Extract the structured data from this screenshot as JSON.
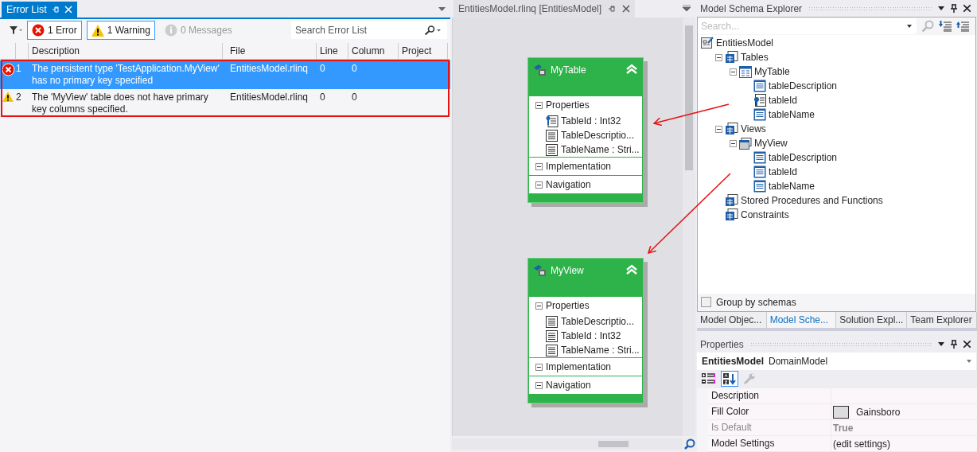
{
  "error_list": {
    "title": "Error List",
    "filters": [
      {
        "kind": "error",
        "label": "1 Error",
        "selected": true
      },
      {
        "kind": "warning",
        "label": "1 Warning",
        "selected": true
      },
      {
        "kind": "message",
        "label": "0 Messages",
        "selected": false
      }
    ],
    "search": {
      "placeholder": "Search Error List"
    },
    "columns": [
      "Description",
      "File",
      "Line",
      "Column",
      "Project"
    ],
    "rows": [
      {
        "kind": "error",
        "number": "1",
        "description": "The persistent type 'TestApplication.MyView' has no primary key specified",
        "file": "EntitiesModel.rlinq",
        "line": "0",
        "column": "0",
        "selected": true
      },
      {
        "kind": "warning",
        "number": "2",
        "description": "The 'MyView' table does not have primary key columns specified.",
        "file": "EntitiesModel.rlinq",
        "line": "0",
        "column": "0",
        "selected": false
      }
    ]
  },
  "designer": {
    "tab": "EntitiesModel.rlinq [EntitiesModel]",
    "entities": [
      {
        "name": "MyTable",
        "sections": [
          {
            "title": "Properties",
            "expanded": true,
            "items": [
              {
                "kind": "key",
                "text": "TableId : Int32"
              },
              {
                "kind": "column",
                "text": "TableDescriptio..."
              },
              {
                "kind": "column",
                "text": "TableName  : Stri..."
              }
            ]
          },
          {
            "title": "Implementation",
            "expanded": true
          },
          {
            "title": "Navigation",
            "expanded": true
          }
        ]
      },
      {
        "name": "MyView",
        "sections": [
          {
            "title": "Properties",
            "expanded": true,
            "items": [
              {
                "kind": "column",
                "text": "TableDescriptio..."
              },
              {
                "kind": "column",
                "text": "TableId : Int32"
              },
              {
                "kind": "column",
                "text": "TableName  : Stri..."
              }
            ]
          },
          {
            "title": "Implementation",
            "expanded": true
          },
          {
            "title": "Navigation",
            "expanded": true
          }
        ]
      }
    ]
  },
  "schema_explorer": {
    "title": "Model Schema Explorer",
    "search": {
      "placeholder": "Search..."
    },
    "tree": [
      {
        "kind": "model",
        "label": "EntitiesModel",
        "children": [
          {
            "kind": "folder",
            "label": "Tables",
            "expanded": true,
            "children": [
              {
                "kind": "table",
                "label": "MyTable",
                "expanded": true,
                "children": [
                  {
                    "kind": "column",
                    "label": "tableDescription"
                  },
                  {
                    "kind": "key",
                    "label": "tableId"
                  },
                  {
                    "kind": "column",
                    "label": "tableName"
                  }
                ]
              }
            ]
          },
          {
            "kind": "folder",
            "label": "Views",
            "expanded": true,
            "children": [
              {
                "kind": "view",
                "label": "MyView",
                "expanded": true,
                "children": [
                  {
                    "kind": "column",
                    "label": "tableDescription"
                  },
                  {
                    "kind": "column",
                    "label": "tableId"
                  },
                  {
                    "kind": "column",
                    "label": "tableName"
                  }
                ]
              }
            ]
          },
          {
            "kind": "folder",
            "label": "Stored Procedures and Functions"
          },
          {
            "kind": "folder",
            "label": "Constraints"
          }
        ]
      }
    ],
    "group_by_schemas": {
      "label": "Group by schemas",
      "checked": false
    },
    "tabs": [
      {
        "label": "Model Objec...",
        "selected": false
      },
      {
        "label": "Model Sche...",
        "selected": true
      },
      {
        "label": "Solution Expl...",
        "selected": false
      },
      {
        "label": "Team Explorer",
        "selected": false
      }
    ]
  },
  "properties": {
    "title": "Properties",
    "object_name": "EntitiesModel",
    "object_type": "DomainModel",
    "rows": [
      {
        "kind": "text",
        "name": "Description",
        "disabled": false
      },
      {
        "kind": "color",
        "name": "Fill Color",
        "value": "Gainsboro",
        "color": "#dcdcdc",
        "disabled": false
      },
      {
        "kind": "bold",
        "name": "Is Default",
        "value": "True",
        "disabled": true
      },
      {
        "kind": "text",
        "name": "Model Settings",
        "value": "(edit settings)",
        "disabled": false
      }
    ]
  }
}
